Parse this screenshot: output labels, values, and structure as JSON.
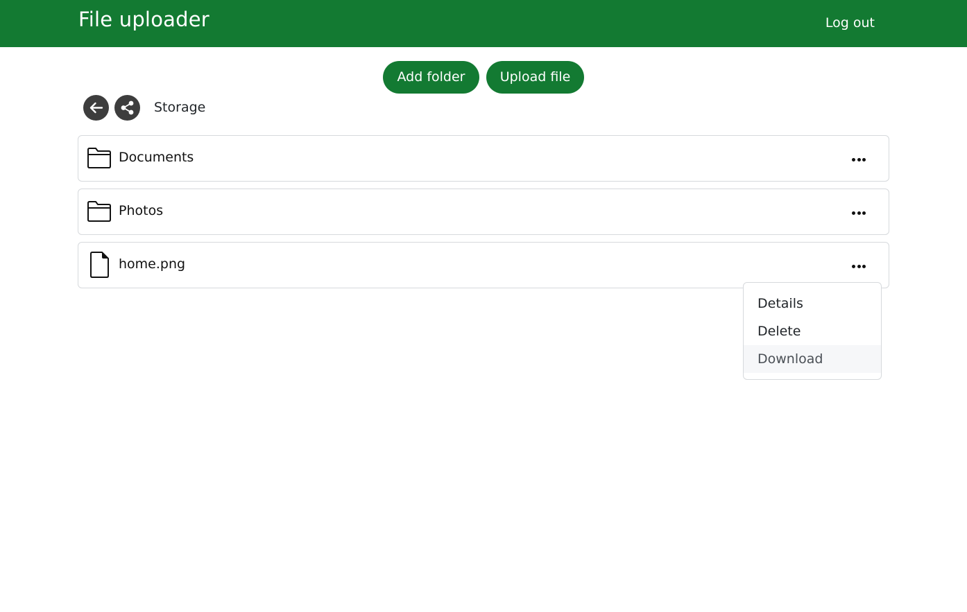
{
  "header": {
    "brand": "File uploader",
    "logout_label": "Log out",
    "background_color": "#137a32"
  },
  "toolbar": {
    "add_folder_label": "Add folder",
    "upload_file_label": "Upload file"
  },
  "breadcrumb": {
    "back_icon": "arrow-left-icon",
    "share_icon": "share-icon",
    "current": "Storage"
  },
  "items": [
    {
      "name": "Documents",
      "type": "folder",
      "icon": "folder-icon"
    },
    {
      "name": "Photos",
      "type": "folder",
      "icon": "folder-icon"
    },
    {
      "name": "home.png",
      "type": "file",
      "icon": "file-icon"
    }
  ],
  "context_menu": {
    "items": [
      {
        "label": "Details"
      },
      {
        "label": "Delete"
      },
      {
        "label": "Download",
        "hovered": true
      }
    ]
  }
}
